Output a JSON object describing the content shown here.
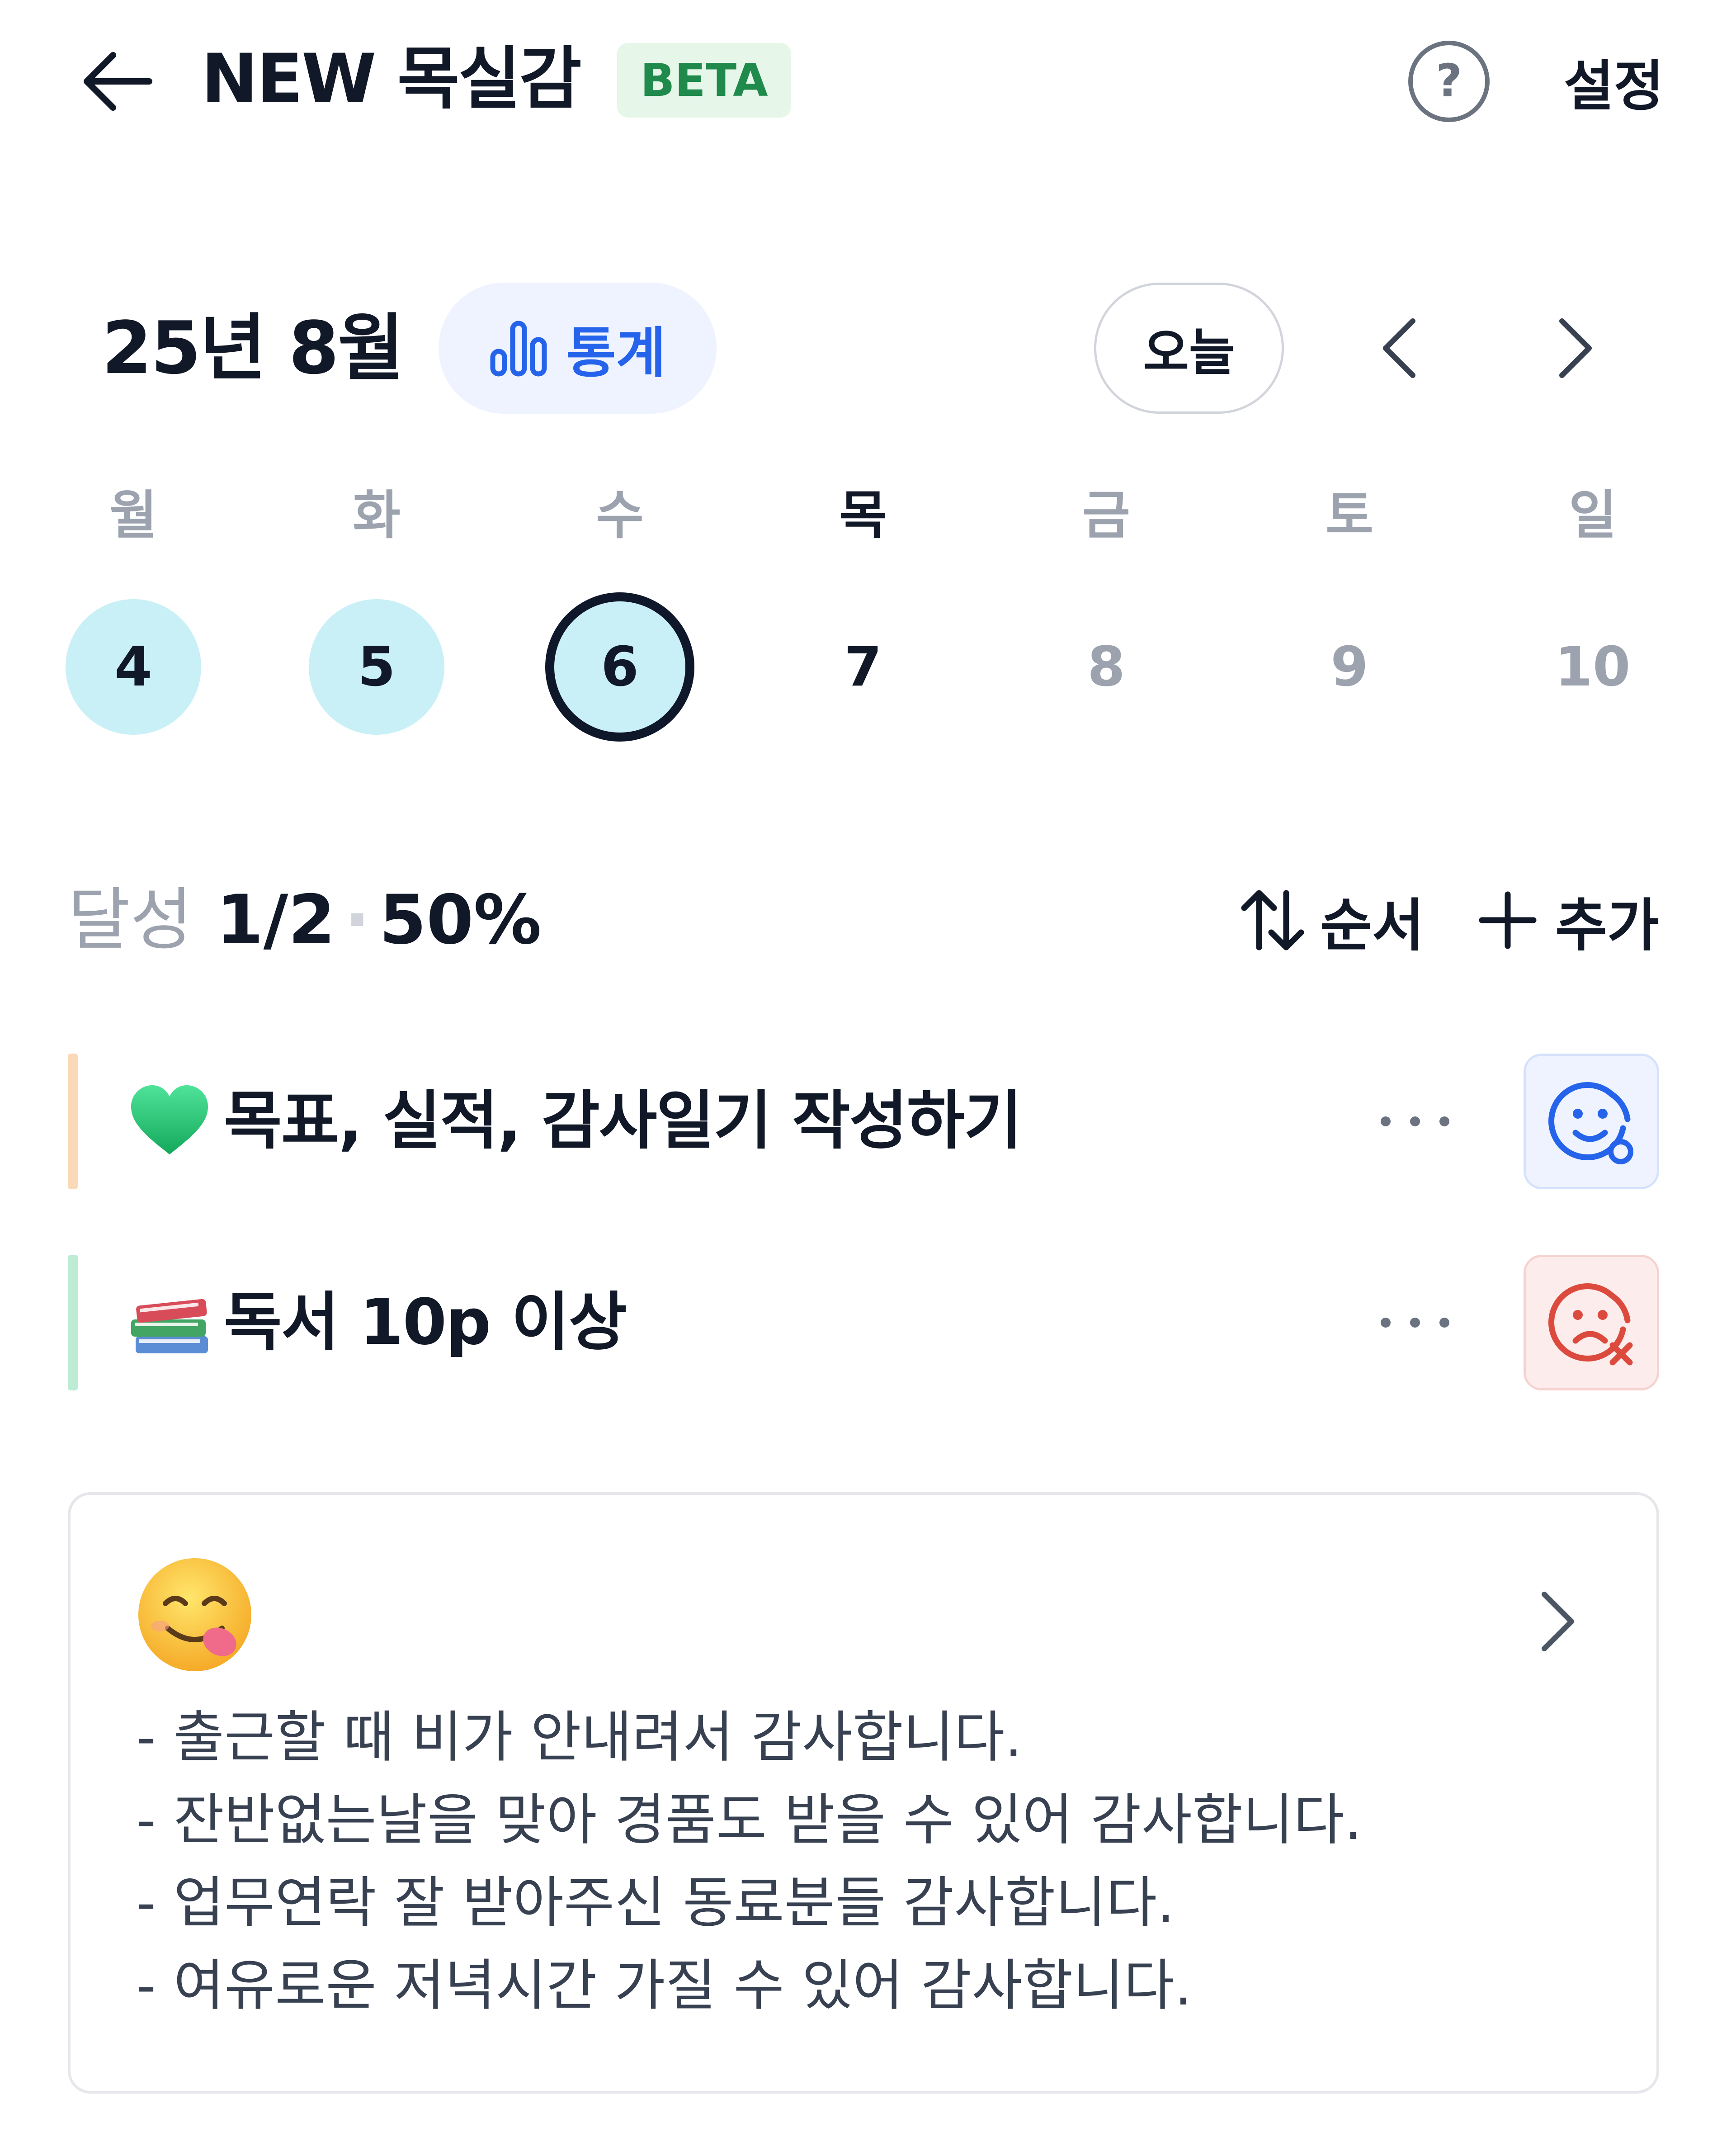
{
  "header": {
    "title": "NEW 목실감",
    "badge": "BETA",
    "settings_label": "설정",
    "icons": [
      "back-arrow-icon",
      "help-icon"
    ]
  },
  "calendar": {
    "month_label": "25년 8월",
    "stats_label": "통계",
    "today_label": "오늘",
    "weekdays": [
      "월",
      "화",
      "수",
      "목",
      "금",
      "토",
      "일"
    ],
    "days": [
      {
        "label": "4",
        "state": "done"
      },
      {
        "label": "5",
        "state": "done"
      },
      {
        "label": "6",
        "state": "done-selected"
      },
      {
        "label": "7",
        "state": "today"
      },
      {
        "label": "8",
        "state": "future"
      },
      {
        "label": "9",
        "state": "future"
      },
      {
        "label": "10",
        "state": "future"
      }
    ]
  },
  "progress": {
    "label": "달성",
    "fraction": "1/2",
    "separator": "·",
    "percent": "50%",
    "sort_label": "순서",
    "add_label": "추가"
  },
  "tasks": [
    {
      "emoji": "green-heart-icon",
      "title": "목표, 실적, 감사일기 작성하기",
      "accent": "#FAD9B8",
      "status": "done"
    },
    {
      "emoji": "books-icon",
      "title": "독서 10p 이상",
      "accent": "#BDEBD4",
      "status": "failed"
    }
  ],
  "gratitude": {
    "mood_icon": "yum-face-icon",
    "lines": [
      "- 출근할 때 비가 안내려서 감사합니다.",
      "- 잔반없는날을 맞아 경품도 받을 수 있어 감사합니다.",
      "- 업무연락 잘 받아주신 동료분들 감사합니다.",
      "- 여유로운 저녁시간 가질 수 있어 감사합니다."
    ]
  },
  "colors": {
    "done_day": "#C9F0F6",
    "accent_blue": "#2563EB",
    "success_bg": "#EEF3FF",
    "fail_bg": "#FDECEC",
    "fail_red": "#DC4A3D"
  }
}
